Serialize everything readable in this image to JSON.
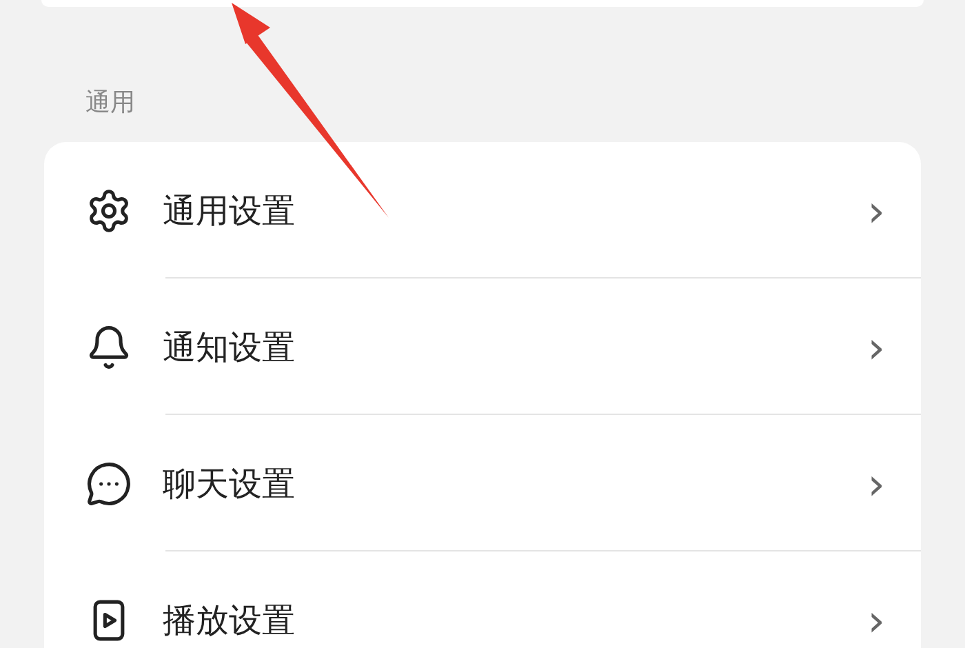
{
  "section": {
    "title": "通用"
  },
  "items": [
    {
      "kind": "gear",
      "label": "通用设置",
      "chevron": "›"
    },
    {
      "kind": "bell",
      "label": "通知设置",
      "chevron": "›"
    },
    {
      "kind": "chat",
      "label": "聊天设置",
      "chevron": "›"
    },
    {
      "kind": "play",
      "label": "播放设置",
      "chevron": "›"
    }
  ]
}
